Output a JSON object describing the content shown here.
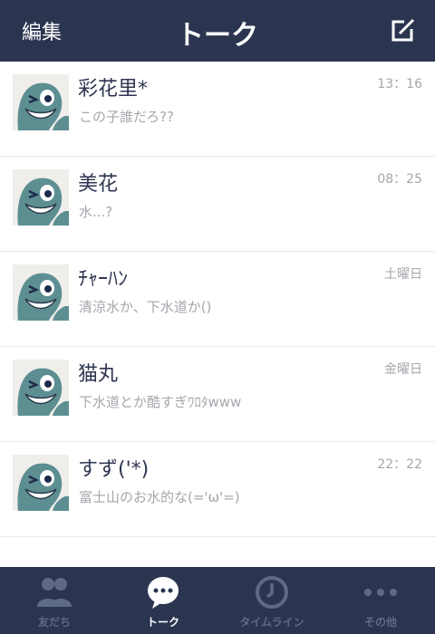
{
  "header": {
    "left_label": "編集",
    "title": "トーク",
    "compose_icon": "compose-icon"
  },
  "chats": [
    {
      "name": "彩花里*",
      "preview": "この子誰だろ??",
      "time": "13：16"
    },
    {
      "name": "美花",
      "preview": "水...?",
      "time": "08：25"
    },
    {
      "name": "ﾁｬｰﾊﾝ",
      "preview": "清涼水か、下水道か()",
      "time": "土曜日"
    },
    {
      "name": "猫丸",
      "preview": "下水道とか酷すぎﾜﾛﾀwww",
      "time": "金曜日"
    },
    {
      "name": "すず('*)",
      "preview": "富士山のお水的な(='ω'=)",
      "time": "22：22"
    }
  ],
  "tabs": [
    {
      "label": "友だち",
      "icon": "friends-icon",
      "active": false
    },
    {
      "label": "トーク",
      "icon": "talk-bubble-icon",
      "active": true
    },
    {
      "label": "タイムライン",
      "icon": "clock-icon",
      "active": false
    },
    {
      "label": "その他",
      "icon": "more-dots-icon",
      "active": false
    }
  ],
  "colors": {
    "header_bg": "#2b3550",
    "name_text": "#2e3550",
    "muted_text": "#a6a6ad",
    "active_tab": "#ffffff",
    "inactive_tab": "#5e6a87"
  }
}
